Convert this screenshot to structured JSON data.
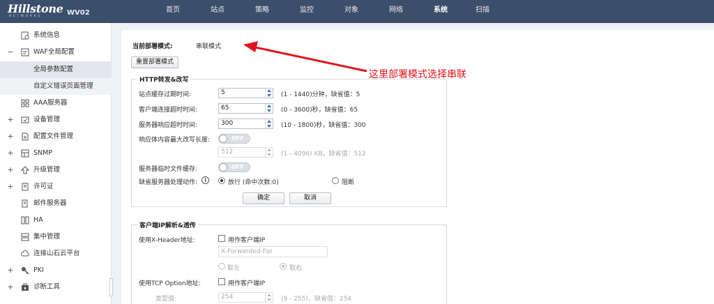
{
  "header": {
    "brand": "Hillstone",
    "brand_tag": "NETWORKS",
    "model": "WV02",
    "nav": [
      {
        "label": "首页"
      },
      {
        "label": "站点"
      },
      {
        "label": "策略"
      },
      {
        "label": "监控"
      },
      {
        "label": "对象"
      },
      {
        "label": "网络"
      },
      {
        "label": "系统",
        "active": true
      },
      {
        "label": "扫描"
      }
    ]
  },
  "sidebar": {
    "items": [
      {
        "label": "系统信息",
        "icon": "system-info-icon",
        "expander": ""
      },
      {
        "label": "WAF全局配置",
        "icon": "waf-config-icon",
        "expander": "−"
      },
      {
        "label": "全局参数配置",
        "sub": true,
        "selected": true
      },
      {
        "label": "自定义错误页面管理",
        "sub": true
      },
      {
        "label": "AAA服务器",
        "icon": "aaa-server-icon",
        "expander": ""
      },
      {
        "label": "设备管理",
        "icon": "device-icon",
        "expander": "+"
      },
      {
        "label": "配置文件管理",
        "icon": "config-file-icon",
        "expander": "+"
      },
      {
        "label": "SNMP",
        "icon": "snmp-icon",
        "expander": "+"
      },
      {
        "label": "升级管理",
        "icon": "upgrade-icon",
        "expander": "+"
      },
      {
        "label": "许可证",
        "icon": "license-icon",
        "expander": "+"
      },
      {
        "label": "邮件服务器",
        "icon": "mail-server-icon",
        "expander": ""
      },
      {
        "label": "HA",
        "icon": "ha-icon",
        "expander": ""
      },
      {
        "label": "集中管理",
        "icon": "central-mgmt-icon",
        "expander": ""
      },
      {
        "label": "连接山石云平台",
        "icon": "cloud-icon",
        "expander": ""
      },
      {
        "label": "PKI",
        "icon": "pki-icon",
        "expander": "+"
      },
      {
        "label": "诊断工具",
        "icon": "diagnose-icon",
        "expander": "+"
      }
    ]
  },
  "main": {
    "deploy_mode_label": "当前部署模式:",
    "deploy_mode_value": "串联模式",
    "reset_button": "重置部署模式",
    "http_section": {
      "legend": "HTTP转发&改写",
      "site_cache_label": "站点缓存过期时间:",
      "site_cache_value": "5",
      "site_cache_hint": "(1 - 1440)分钟，缺省值：5",
      "client_timeout_label": "客户端连接超时时间:",
      "client_timeout_value": "65",
      "client_timeout_hint": "(0 - 3600)秒，缺省值：65",
      "server_timeout_label": "服务器响应超时时间:",
      "server_timeout_value": "300",
      "server_timeout_hint": "(10 - 1800)秒，缺省值：300",
      "rewrite_len_label": "响应体内容最大改写长度:",
      "rewrite_toggle": "OFF",
      "rewrite_len_value": "512",
      "rewrite_len_hint": "(1 - 4096) KB，缺省值：512",
      "temp_cache_label": "服务器临时文件缓存:",
      "temp_cache_toggle": "OFF",
      "default_action_label": "缺省服务器处理动作:",
      "action_pass": "放行 (命中次数:0)",
      "action_block": "阻断",
      "ok_button": "确定",
      "cancel_button": "取消"
    },
    "client_ip_section": {
      "legend": "客户端IP解析&透传",
      "xheader_label": "使用X-Header地址:",
      "xheader_check": "用作客户端IP",
      "xheader_placeholder": "X-Forwarded-For",
      "take_left": "取左",
      "take_right": "取右",
      "tcp_option_label": "使用TCP Option地址:",
      "tcp_option_check": "用作客户端IP",
      "type_label": "类型值:",
      "type_value": "254",
      "type_hint": "(9 - 255)，缺省值：254"
    }
  },
  "annotation": {
    "text": "这里部署模式选择串联",
    "color": "#e0141e"
  }
}
